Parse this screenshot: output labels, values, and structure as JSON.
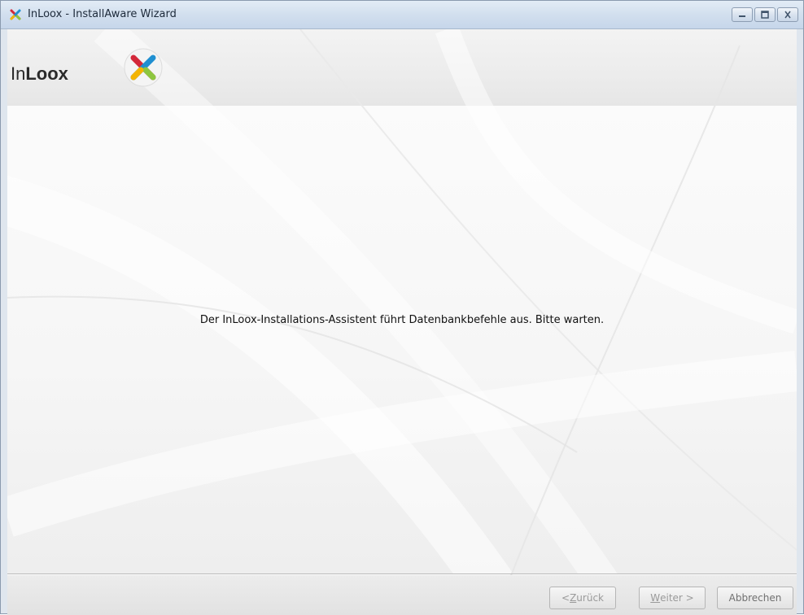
{
  "window": {
    "title": "InLoox - InstallAware Wizard"
  },
  "header": {
    "brand_light": "In",
    "brand_bold": "Loox"
  },
  "main": {
    "message": "Der InLoox-Installations-Assistent führt Datenbankbefehle aus. Bitte warten."
  },
  "footer": {
    "back": {
      "prefix": "< ",
      "key": "Z",
      "rest": "urück"
    },
    "next": {
      "prefix": "",
      "key": "W",
      "rest": "eiter >"
    },
    "cancel": "Abbrechen"
  },
  "icons": {
    "title": "inloox-x-icon",
    "minimize": "minimize-icon",
    "maximize": "maximize-icon",
    "close": "close-icon"
  },
  "colors": {
    "logo_red": "#d3283a",
    "logo_green": "#8dc63f",
    "logo_blue": "#1f8fd1",
    "logo_yellow": "#f4b400"
  }
}
